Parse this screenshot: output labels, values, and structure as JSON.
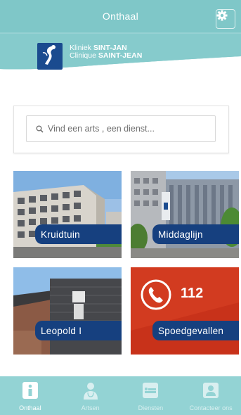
{
  "header": {
    "title": "Onthaal",
    "settings_icon": "gear-icon",
    "bg_color": "#7fc7c8"
  },
  "brand": {
    "line1_prefix": "Kliniek ",
    "line1_bold": "SINT-JAN",
    "line2_prefix": "Clinique ",
    "line2_bold": "SAINT-JEAN",
    "logo_icon": "saint-logo-icon"
  },
  "search": {
    "placeholder": "Vind een arts , een dienst...",
    "icon": "search-icon"
  },
  "tiles": [
    {
      "label": "Kruidtuin"
    },
    {
      "label": "Middaglijn"
    },
    {
      "label": "Leopold I"
    },
    {
      "label": "Spoedgevallen",
      "number": "112",
      "icon": "phone-icon",
      "bg_color": "#c8321a"
    }
  ],
  "nav": {
    "items": [
      {
        "label": "Onthaal",
        "icon": "info-icon",
        "active": true
      },
      {
        "label": "Artsen",
        "icon": "doctor-icon",
        "active": false
      },
      {
        "label": "Diensten",
        "icon": "bed-icon",
        "active": false
      },
      {
        "label": "Contacteer ons",
        "icon": "contact-icon",
        "active": false
      }
    ]
  }
}
